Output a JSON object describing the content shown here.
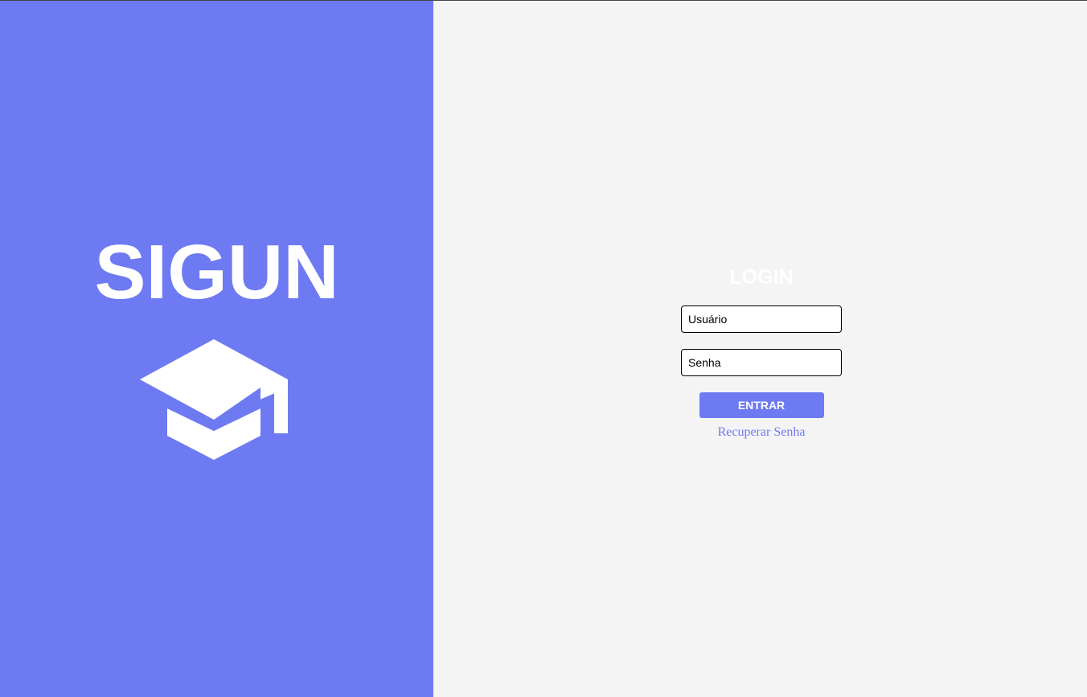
{
  "brand": {
    "title": "SIGUN",
    "icon": "graduation-cap-icon",
    "background_color": "#6e7af2"
  },
  "login": {
    "title": "LOGIN",
    "username_placeholder": "Usuário",
    "password_placeholder": "Senha",
    "submit_label": "ENTRAR",
    "recover_link": "Recuperar Senha",
    "accent_color": "#6e7af2",
    "background_color": "#f4f4f4"
  }
}
